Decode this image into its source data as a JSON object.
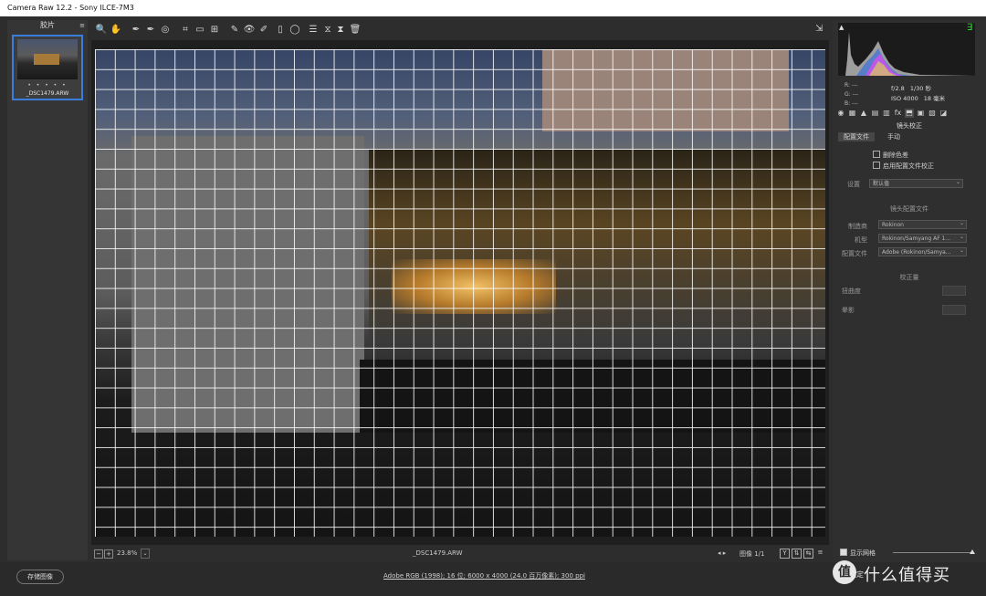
{
  "window": {
    "title": "Camera Raw 12.2 -  Sony ILCE-7M3"
  },
  "filmstrip": {
    "header": "胶片",
    "menu_icon": "≡",
    "thumbnail": {
      "stars": "• • • • •",
      "filename": "_DSC1479.ARW"
    }
  },
  "toolbar": {
    "tools": [
      "zoom-icon",
      "hand-icon",
      "white-balance-icon",
      "color-sampler-icon",
      "targeted-adjust-icon",
      "crop-icon",
      "straighten-icon",
      "transform-icon",
      "spot-removal-icon",
      "red-eye-icon",
      "adjustment-brush-icon",
      "graduated-filter-icon",
      "radial-filter-icon",
      "preferences-icon",
      "rotate-left-icon",
      "rotate-right-icon",
      "trash-icon"
    ],
    "tool_glyphs": [
      "🔍",
      "✋",
      "✒",
      "✒",
      "◎",
      "⌗",
      "▭",
      "⊞",
      "✎",
      "👁",
      "✐",
      "▯",
      "◯",
      "☰",
      "⧖",
      "⧗",
      "🗑"
    ],
    "export_glyph": "⇲"
  },
  "canvas": {
    "zoom": "23.8%",
    "filename": "_DSC1479.ARW",
    "nav_arrows": "◂ ▸",
    "image_count": "图像 1/1",
    "view_buttons": [
      "Y",
      "⇅",
      "⇆",
      "≡"
    ]
  },
  "status": {
    "save_label": "存储图像",
    "workflow_text": "Adobe RGB (1998); 16 位; 6000 x 4000 (24.0 百万像素); 300 ppi",
    "ok_label": "确定"
  },
  "histogram": {
    "clip_left": "▲",
    "clip_right": "∃",
    "r": "R:   ---",
    "g": "G:   ---",
    "b": "B:   ---",
    "aperture": "f/2.8",
    "shutter": "1/30 秒",
    "iso": "ISO 4000",
    "focal": "18 毫米"
  },
  "panel": {
    "section_title": "镜头校正",
    "tab_icons": [
      "◉",
      "▦",
      "▲",
      "▤",
      "▥",
      "fx",
      "⬒",
      "▣",
      "▧",
      "◪"
    ],
    "subtabs": [
      "配置文件",
      "手动"
    ],
    "remove_ca": "删除色差",
    "enable_profile": "启用配置文件校正",
    "setup_label": "设置",
    "setup_value": "默认值",
    "lens_profile_head": "镜头配置文件",
    "make_label": "制造商",
    "make_value": "Rokinon",
    "model_label": "机型",
    "model_value": "Rokinon/Samyang AF 1...",
    "profile_label": "配置文件",
    "profile_value": "Adobe (Rokinon/Samya...",
    "correction_head": "校正量",
    "distortion_label": "扭曲度",
    "vignette_label": "晕影",
    "show_grid": "显示网格"
  },
  "watermark": {
    "logo_char": "值",
    "text": "什么值得买"
  },
  "colors": {
    "accent": "#3b7ddb",
    "panel_bg": "#2f2f2f",
    "canvas_bg": "#1f1f1f",
    "clip_green": "#3ae03a"
  }
}
